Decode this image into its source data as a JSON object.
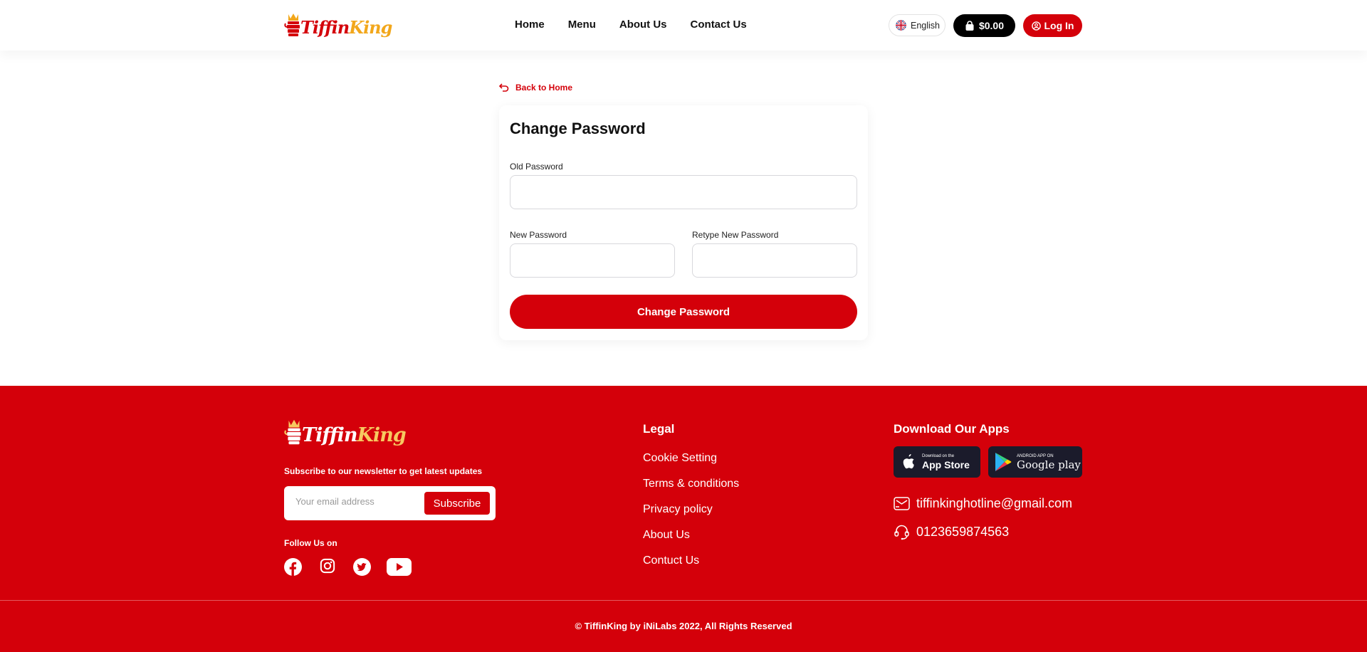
{
  "header": {
    "logo_text_part1": "Tiffin",
    "logo_text_part2": "King",
    "nav": [
      "Home",
      "Menu",
      "About Us",
      "Contact Us"
    ],
    "language": "English",
    "cart_total": "$0.00",
    "login_label": "Log In"
  },
  "main": {
    "back_label": "Back to Home",
    "title": "Change Password",
    "old_password_label": "Old Password",
    "new_password_label": "New Password",
    "retype_password_label": "Retype New Password",
    "submit_label": "Change Password"
  },
  "footer": {
    "newsletter_text": "Subscribe to our newsletter to get latest updates",
    "email_placeholder": "Your email address",
    "subscribe_label": "Subscribe",
    "follow_label": "Follow Us on",
    "social_icons": [
      "facebook-icon",
      "instagram-icon",
      "twitter-icon",
      "youtube-icon"
    ],
    "legal_title": "Legal",
    "legal_links": [
      "Cookie Setting",
      "Terms & conditions",
      "Privacy policy",
      "About Us",
      "Contuct Us"
    ],
    "apps_title": "Download Our Apps",
    "app_store_small": "Download on the",
    "app_store_big": "App Store",
    "google_play_small": "ANDROID APP ON",
    "google_play_big": "Google play",
    "email": "tiffinkinghotline@gmail.com",
    "phone": "0123659874563",
    "copyright": "© TiffinKing by iNiLabs 2022, All Rights Reserved"
  },
  "colors": {
    "brand_red": "#d4000a",
    "brand_gold": "#f2a71b",
    "dark": "#000000",
    "store_badge": "#1b1b2b"
  }
}
